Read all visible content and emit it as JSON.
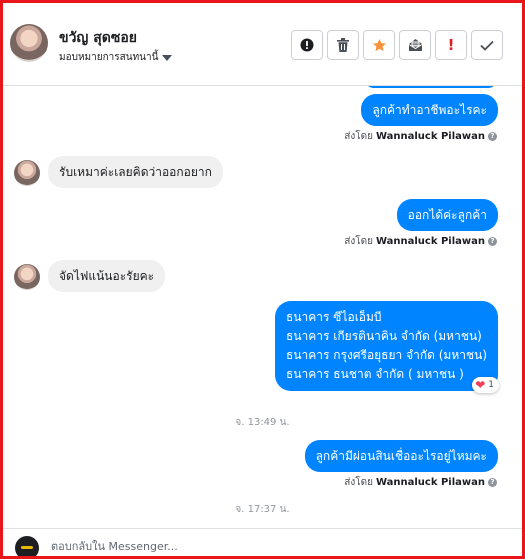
{
  "header": {
    "contact_name": "ขวัญ สุดซอย",
    "assign_label": "มอบหมายการสนทนานี้",
    "actions": [
      {
        "name": "report-button",
        "icon": "exclamation-circle-icon"
      },
      {
        "name": "delete-button",
        "icon": "trash-icon"
      },
      {
        "name": "star-button",
        "icon": "star-icon",
        "color": "#f7923a"
      },
      {
        "name": "mark-unread-button",
        "icon": "envelope-open-icon"
      },
      {
        "name": "spam-button",
        "label": "!",
        "color": "#e02020"
      },
      {
        "name": "done-button",
        "icon": "check-icon"
      }
    ]
  },
  "messages": [
    {
      "dir": "out",
      "text": "ลูกค้าทำอาชีพอะไรคะ",
      "sent_by_prefix": "ส่งโดย",
      "sent_by_name": "Wannaluck Pilawan"
    },
    {
      "dir": "in",
      "text": "รับเหมาค่ะเลยคิดว่าออกอยาก"
    },
    {
      "dir": "out",
      "text": "ออกได้ค่ะลูกค้า",
      "sent_by_prefix": "ส่งโดย",
      "sent_by_name": "Wannaluck Pilawan"
    },
    {
      "dir": "in",
      "text": "จัดไฟแน้นอะรัยคะ"
    },
    {
      "dir": "out",
      "lines": [
        "ธนาคาร ซีไอเอ็มบี",
        "ธนาคาร เกียรตินาคิน จำกัด (มหาชน)",
        "ธนาคาร กรุงศรีอยุธยา จำกัด (มหาชน)",
        "ธนาคาร ธนชาต จำกัด ( มหาชน )"
      ],
      "reaction": {
        "icon": "heart-icon",
        "count": "1"
      }
    },
    {
      "dir": "timestamp",
      "text": "จ. 13:49 น."
    },
    {
      "dir": "out",
      "text": "ลูกค้ามีผ่อนสินเชื่ออะไรอยู่ไหมคะ",
      "sent_by_prefix": "ส่งโดย",
      "sent_by_name": "Wannaluck Pilawan"
    },
    {
      "dir": "timestamp",
      "text": "จ. 17:37 น."
    }
  ],
  "composer": {
    "placeholder": "ตอบกลับใน Messenger..."
  },
  "colors": {
    "outgoing_bubble": "#0084ff",
    "incoming_bubble": "#f1f0f0",
    "frame_border": "#e8161b"
  }
}
